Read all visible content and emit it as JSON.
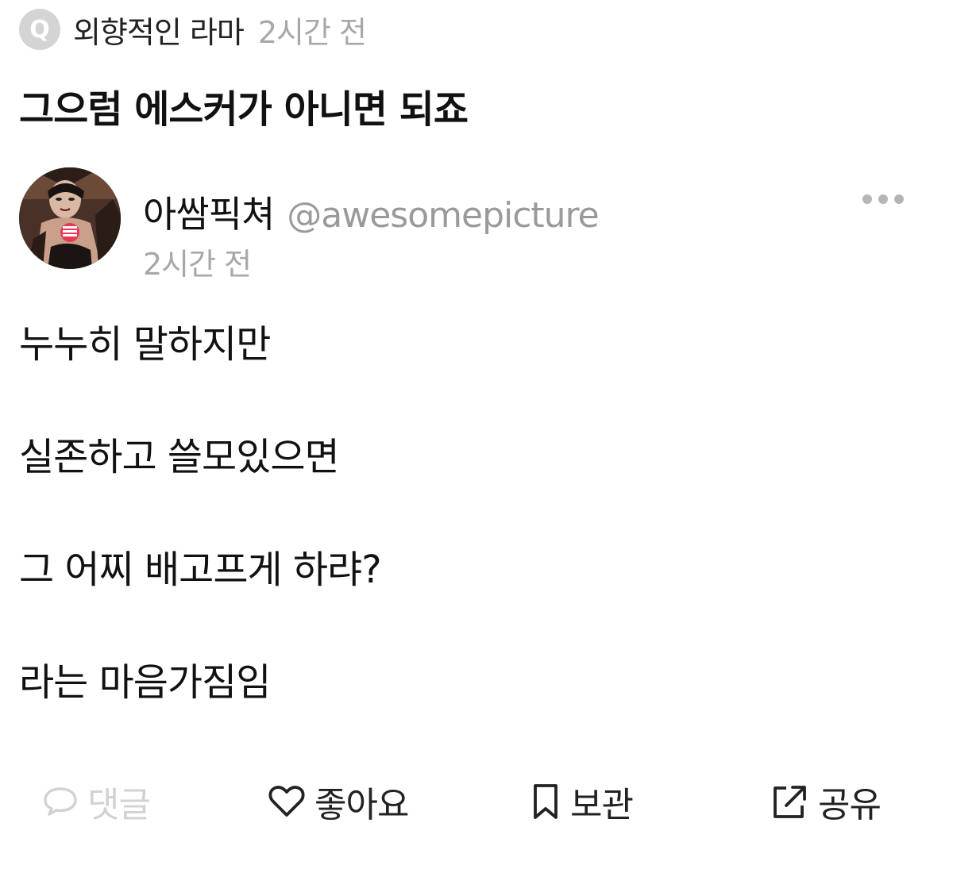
{
  "question": {
    "badge_letter": "Q",
    "asker_name": "외향적인 라마",
    "time": "2시간 전",
    "text": "그으럼 에스커가 아니면 되죠"
  },
  "answer": {
    "author_name": "아쌈픽쳐",
    "author_handle": "@awesomepicture",
    "time": "2시간 전",
    "more_icon": "more-horizontal-icon",
    "body_lines": [
      "누누히 말하지만",
      "실존하고 쓸모있으면",
      "그 어찌 배고프게 하랴?",
      "라는 마음가짐임"
    ]
  },
  "actions": {
    "comment": {
      "label": "댓글",
      "icon": "speech-bubble-icon",
      "enabled": false
    },
    "like": {
      "label": "좋아요",
      "icon": "heart-icon"
    },
    "save": {
      "label": "보관",
      "icon": "bookmark-icon"
    },
    "share": {
      "label": "공유",
      "icon": "share-icon"
    }
  },
  "colors": {
    "text": "#111111",
    "muted": "#a8a8a8",
    "disabled": "#d2d2d2",
    "badge": "#d4d4d4"
  }
}
